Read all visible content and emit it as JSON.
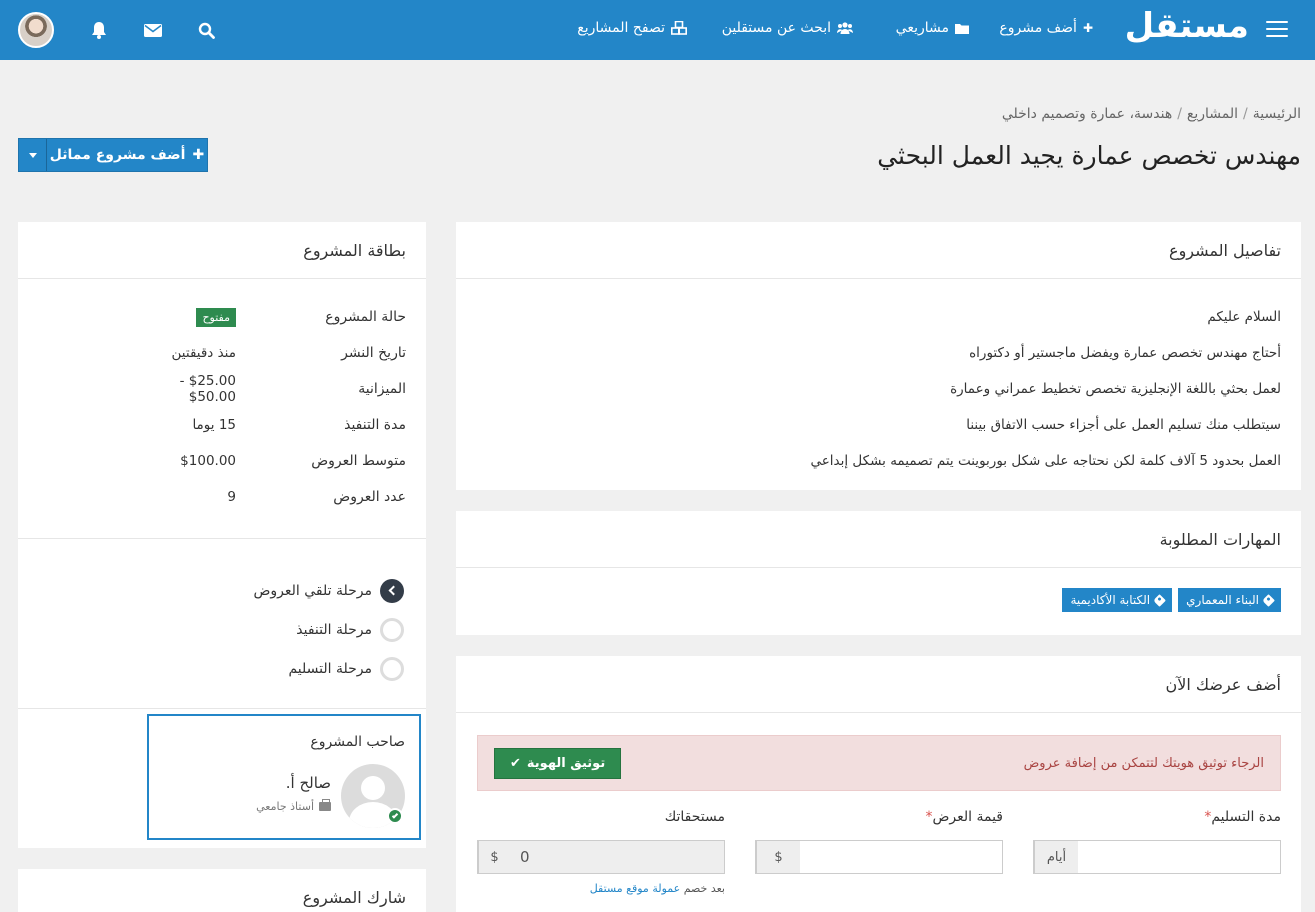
{
  "nav": {
    "logo": "مستقل",
    "links": {
      "add_project": "أضف مشروع",
      "my_projects": "مشاريعي",
      "find_freelancers": "ابحث عن مستقلين",
      "browse_projects": "تصفح المشاريع"
    }
  },
  "breadcrumb": [
    "الرئيسية",
    "المشاريع",
    "هندسة، عمارة وتصميم داخلي"
  ],
  "page_title": "مهندس تخصص عمارة يجيد العمل البحثي",
  "similar_button": "أضف مشروع مماثل",
  "details": {
    "title": "تفاصيل المشروع",
    "lines": [
      "السلام عليكم",
      "أحتاج مهندس تخصص عمارة ويفضل ماجستير أو دكتوراه",
      "لعمل بحثي باللغة الإنجليزية تخصص تخطيط عمراني وعمارة",
      "سيتطلب منك تسليم العمل على أجزاء حسب الاتفاق بيننا",
      "العمل بحدود 5 آلاف كلمة لكن نحتاجه على شكل بوربوينت يتم تصميمه بشكل إبداعي"
    ]
  },
  "skills": {
    "title": "المهارات المطلوبة",
    "items": [
      "البناء المعماري",
      "الكتابة الأكاديمية"
    ]
  },
  "bid": {
    "title": "أضف عرضك الآن",
    "alert": "الرجاء توثيق هويتك لتتمكن من إضافة عروض",
    "verify_button": "توثيق الهوية",
    "duration_label": "مدة التسليم",
    "duration_unit": "أيام",
    "amount_label": "قيمة العرض",
    "currency": "$",
    "earnings_label": "مستحقاتك",
    "earnings_value": "0",
    "commission_prefix": "بعد خصم",
    "commission_link": "عمولة موقع مستقل",
    "required_mark": "*"
  },
  "card": {
    "title": "بطاقة المشروع",
    "rows": [
      {
        "k": "حالة المشروع",
        "v": "مفتوح"
      },
      {
        "k": "تاريخ النشر",
        "v": "منذ دقيقتين"
      },
      {
        "k": "الميزانية",
        "v": "$25.00 - $50.00"
      },
      {
        "k": "مدة التنفيذ",
        "v": "15 يوما"
      },
      {
        "k": "متوسط العروض",
        "v": "$100.00"
      },
      {
        "k": "عدد العروض",
        "v": "9"
      }
    ],
    "stages": [
      "مرحلة تلقي العروض",
      "مرحلة التنفيذ",
      "مرحلة التسليم"
    ],
    "active_stage": 0
  },
  "owner": {
    "title": "صاحب المشروع",
    "name": "صالح أ.",
    "role": "أستاذ جامعي",
    "verified": true
  },
  "share": {
    "title": "شارك المشروع"
  },
  "colors": {
    "primary": "#2386c8",
    "success": "#2e8b4f",
    "danger_bg": "#f2dede",
    "danger_text": "#a94442"
  }
}
